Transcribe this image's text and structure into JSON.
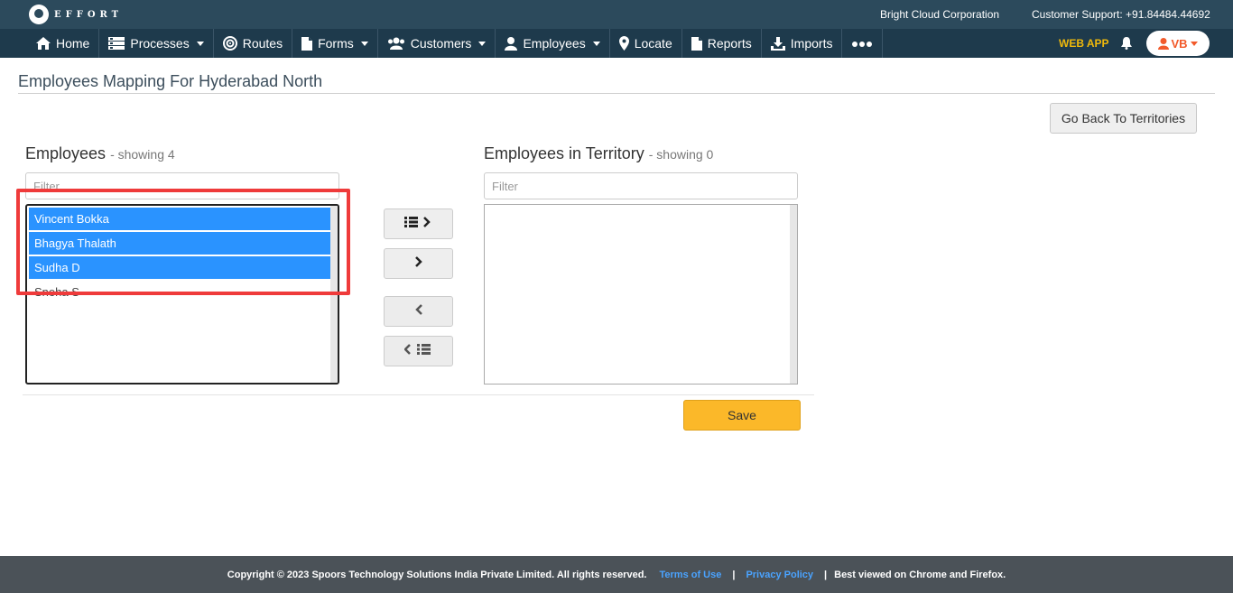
{
  "header": {
    "logo_text": "EFFORT",
    "company": "Bright Cloud Corporation",
    "support": "Customer Support: +91.84484.44692"
  },
  "nav": {
    "items": [
      {
        "label": "Home",
        "icon": "home-icon"
      },
      {
        "label": "Processes",
        "icon": "server-icon"
      },
      {
        "label": "Routes",
        "icon": "target-icon"
      },
      {
        "label": "Forms",
        "icon": "file-icon"
      },
      {
        "label": "Customers",
        "icon": "users-icon"
      },
      {
        "label": "Employees",
        "icon": "user-icon"
      },
      {
        "label": "Locate",
        "icon": "map-marker-icon"
      },
      {
        "label": "Reports",
        "icon": "file-icon"
      },
      {
        "label": "Imports",
        "icon": "download-icon"
      }
    ],
    "webapp_label": "WEB APP",
    "user_initials": "VB"
  },
  "page": {
    "title": "Employees Mapping For Hyderabad North",
    "back_button": "Go Back To Territories"
  },
  "left_list": {
    "heading": "Employees",
    "count": "- showing 4",
    "filter_placeholder": "Filter",
    "items": [
      {
        "name": "Vincent Bokka",
        "selected": true
      },
      {
        "name": "Bhagya Thalath",
        "selected": true
      },
      {
        "name": "Sudha D",
        "selected": true
      },
      {
        "name": "Sneha S",
        "selected": false
      }
    ]
  },
  "right_list": {
    "heading": "Employees in Territory",
    "count": "- showing 0",
    "filter_placeholder": "Filter",
    "items": []
  },
  "actions": {
    "save": "Save"
  },
  "footer": {
    "copyright": "Copyright © 2023 Spoors Technology Solutions India Private Limited. All rights reserved.",
    "terms": "Terms of Use",
    "privacy": "Privacy Policy",
    "best_viewed": "Best viewed on Chrome and Firefox."
  },
  "colors": {
    "topbar": "#2c4a5c",
    "navbar": "#1e3a4c",
    "selection": "#2a93ff",
    "save": "#fbb829",
    "highlight": "#ef3b3b"
  }
}
